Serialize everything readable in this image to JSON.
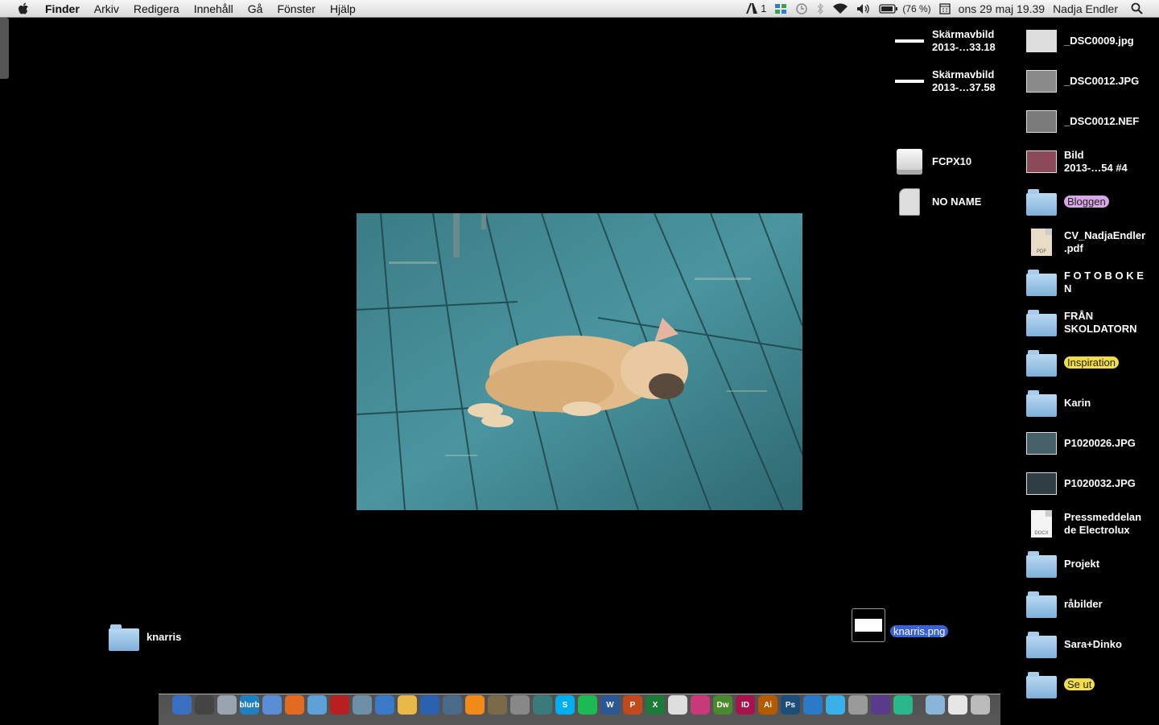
{
  "menubar": {
    "app_name": "Finder",
    "menus": [
      "Arkiv",
      "Redigera",
      "Innehåll",
      "Gå",
      "Fönster",
      "Hjälp"
    ],
    "adobe_count": "1",
    "battery": "(76 %)",
    "datetime": "ons 29 maj  19.39",
    "user": "Nadja Endler"
  },
  "desktop": {
    "col_mid": [
      {
        "name": "Skärmavbild\n2013-…33.18",
        "kind": "screenshot"
      },
      {
        "name": "Skärmavbild\n2013-…37.58",
        "kind": "screenshot"
      },
      {
        "name": "FCPX10",
        "kind": "drive"
      },
      {
        "name": "NO NAME",
        "kind": "sdcard"
      }
    ],
    "col_right": [
      {
        "name": "_DSC0009.jpg",
        "kind": "photo"
      },
      {
        "name": "_DSC0012.JPG",
        "kind": "photo"
      },
      {
        "name": "_DSC0012.NEF",
        "kind": "photo"
      },
      {
        "name": "Bild\n2013-…54 #4",
        "kind": "photo"
      },
      {
        "name": "Bloggen",
        "kind": "folder",
        "tag": "purple"
      },
      {
        "name": "CV_NadjaEndler\n.pdf",
        "kind": "doc",
        "doctype": "PDF"
      },
      {
        "name": "F O T O B O K E\nN",
        "kind": "folder"
      },
      {
        "name": "FRÅN\nSKOLDATORN",
        "kind": "folder"
      },
      {
        "name": "Inspiration",
        "kind": "folder",
        "tag": "yellow"
      },
      {
        "name": "Karin",
        "kind": "folder"
      },
      {
        "name": "P1020026.JPG",
        "kind": "photo"
      },
      {
        "name": "P1020032.JPG",
        "kind": "photo"
      },
      {
        "name": "Pressmeddelan\nde Electrolux",
        "kind": "doc",
        "doctype": "DOCX"
      },
      {
        "name": "Projekt",
        "kind": "folder"
      },
      {
        "name": "råbilder",
        "kind": "folder"
      },
      {
        "name": "Sara+Dinko",
        "kind": "folder"
      },
      {
        "name": "Se ut",
        "kind": "folder",
        "tag": "yellow"
      }
    ],
    "loose": [
      {
        "name": "knarris",
        "kind": "folder"
      },
      {
        "name": "knarris.png",
        "kind": "png",
        "selected": true
      }
    ]
  },
  "dock": {
    "labels": [
      "blurb",
      "W",
      "P",
      "X",
      "Dw",
      "ID",
      "Ai",
      "Ps"
    ],
    "icons": [
      "finder-icon",
      "launchpad-icon",
      "preview-icon",
      "blurb-icon",
      "itunes-icon",
      "firefox-icon",
      "safari-icon",
      "photobooth-icon",
      "iphoto-icon",
      "mail-icon",
      "cyberduck-icon",
      "quicktime-icon",
      "home-icon",
      "vlc-icon",
      "imovie-icon",
      "screenshot-icon",
      "timemachine-icon",
      "skype-icon",
      "spotify-icon",
      "word-icon",
      "powerpoint-icon",
      "excel-icon",
      "textedit-icon",
      "butterfly-icon",
      "dreamweaver-icon",
      "indesign-icon",
      "illustrator-icon",
      "photoshop-icon",
      "vectorworks-icon",
      "idraw-icon",
      "utilities-icon",
      "finalcut-icon",
      "colorsync-icon",
      "applications-stack-icon",
      "documents-stack-icon",
      "trash-icon"
    ],
    "colors": {
      "skype": "#00aff0",
      "spotify": "#1db954",
      "word": "#2b5797",
      "excel": "#1d7a3a",
      "dreamweaver": "#4a8a2c",
      "indesign": "#a7134b",
      "illustrator": "#b45a00",
      "photoshop": "#1b4d7a",
      "powerpoint": "#c1491e"
    }
  }
}
